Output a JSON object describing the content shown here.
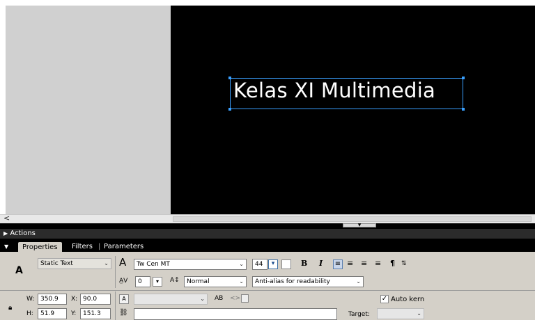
{
  "stage": {
    "text": "Kelas XI Multimedia"
  },
  "scroll": {
    "left_arrow": "<"
  },
  "actions_panel": {
    "label": "Actions"
  },
  "tabs": [
    {
      "label": "Properties"
    },
    {
      "label": "Filters"
    },
    {
      "label": "Parameters"
    }
  ],
  "properties": {
    "tool_icon_glyph": "A",
    "text_type": "Static Text",
    "font_family": "Tw Cen MT",
    "font_size": "44",
    "letter_spacing": "0",
    "char_position": "Normal",
    "anti_alias": "Anti-alias for readability",
    "bold_glyph": "B",
    "italic_glyph": "I",
    "paragraph_glyph": "¶",
    "auto_kern_label": "Auto kern",
    "auto_kern_checked": true,
    "target_label": "Target:",
    "url_value": "",
    "w_label": "W:",
    "w_value": "350.9",
    "x_label": "X:",
    "x_value": "90.0",
    "h_label": "H:",
    "h_value": "51.9",
    "y_label": "Y:",
    "y_value": "151.3"
  },
  "colors": {
    "stage_bg": "#000000",
    "selection": "#3aa0ff",
    "panel_bg": "#d4d0c8"
  }
}
